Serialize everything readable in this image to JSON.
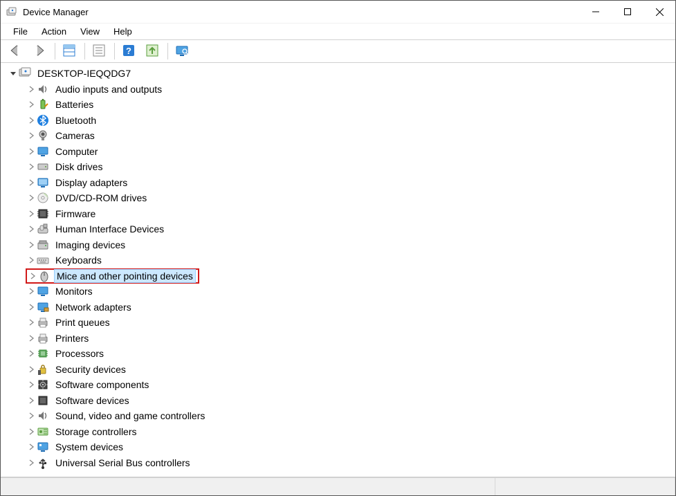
{
  "window": {
    "title": "Device Manager"
  },
  "menus": [
    "File",
    "Action",
    "View",
    "Help"
  ],
  "toolbar": {
    "buttons": [
      {
        "name": "back",
        "icon": "arrow-left"
      },
      {
        "name": "forward",
        "icon": "arrow-right"
      },
      {
        "sep": true
      },
      {
        "name": "show-hidden",
        "icon": "grid-blue"
      },
      {
        "sep": true
      },
      {
        "name": "properties",
        "icon": "properties"
      },
      {
        "sep": true
      },
      {
        "name": "help",
        "icon": "help"
      },
      {
        "name": "update-driver",
        "icon": "driver-up"
      },
      {
        "sep": true
      },
      {
        "name": "scan",
        "icon": "monitor-scan"
      }
    ]
  },
  "tree": {
    "root": {
      "label": "DESKTOP-IEQQDG7",
      "expanded": true,
      "icon": "computer"
    },
    "children": [
      {
        "label": "Audio inputs and outputs",
        "icon": "audio"
      },
      {
        "label": "Batteries",
        "icon": "battery"
      },
      {
        "label": "Bluetooth",
        "icon": "bluetooth"
      },
      {
        "label": "Cameras",
        "icon": "camera"
      },
      {
        "label": "Computer",
        "icon": "monitor"
      },
      {
        "label": "Disk drives",
        "icon": "disk"
      },
      {
        "label": "Display adapters",
        "icon": "display"
      },
      {
        "label": "DVD/CD-ROM drives",
        "icon": "dvd"
      },
      {
        "label": "Firmware",
        "icon": "firmware"
      },
      {
        "label": "Human Interface Devices",
        "icon": "hid"
      },
      {
        "label": "Imaging devices",
        "icon": "imaging"
      },
      {
        "label": "Keyboards",
        "icon": "keyboard"
      },
      {
        "label": "Mice and other pointing devices",
        "icon": "mouse",
        "highlighted": true,
        "red": true
      },
      {
        "label": "Monitors",
        "icon": "monitor"
      },
      {
        "label": "Network adapters",
        "icon": "network"
      },
      {
        "label": "Print queues",
        "icon": "printer"
      },
      {
        "label": "Printers",
        "icon": "printer"
      },
      {
        "label": "Processors",
        "icon": "cpu"
      },
      {
        "label": "Security devices",
        "icon": "security"
      },
      {
        "label": "Software components",
        "icon": "softcomp"
      },
      {
        "label": "Software devices",
        "icon": "softdev"
      },
      {
        "label": "Sound, video and game controllers",
        "icon": "audio"
      },
      {
        "label": "Storage controllers",
        "icon": "storage"
      },
      {
        "label": "System devices",
        "icon": "system"
      },
      {
        "label": "Universal Serial Bus controllers",
        "icon": "usb"
      }
    ]
  }
}
